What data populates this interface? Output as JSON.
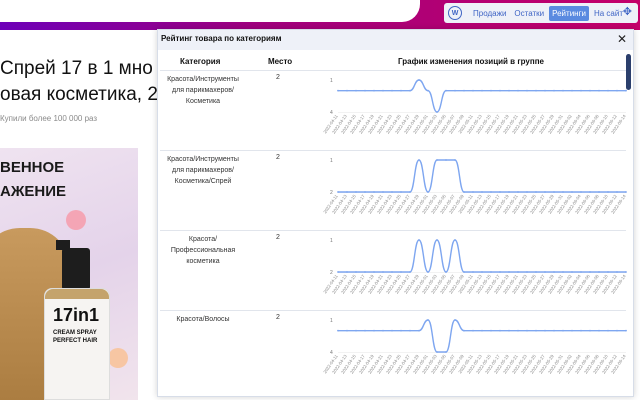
{
  "colors": {
    "accent": "#5a8ae0",
    "brand_top": "#a0007e",
    "line": "#7ea6f0"
  },
  "toolbar": {
    "logo": "W",
    "tabs": [
      {
        "label": "Продажи",
        "active": false
      },
      {
        "label": "Остатки",
        "active": false
      },
      {
        "label": "Рейтинги",
        "active": true
      },
      {
        "label": "На сайт",
        "active": false
      }
    ],
    "move_icon": "move-icon"
  },
  "page": {
    "title_line1": "Спрей 17 в 1 мно",
    "title_line2": "овая косметика, 2",
    "bought": "Купили более 100 000 раз",
    "promo_line1": "ВЕННОЕ",
    "promo_line2": "АЖЕНИЕ",
    "bottle_big": "17in1",
    "bottle_name": "CREAM SPRAY",
    "bottle_sub": "PERFECT HAIR"
  },
  "panel": {
    "title": "Рейтинг товара по категориям",
    "columns": {
      "category": "Категория",
      "place": "Место",
      "chart": "График изменения позиций в группе"
    },
    "rows": [
      {
        "category": "Красота/Инструменты для парикмахеров/Косметика",
        "place": "2"
      },
      {
        "category": "Красота/Инструменты для парикмахеров/Косметика/Спрей",
        "place": "2"
      },
      {
        "category": "Красота/ Профессиональная косметика",
        "place": "2"
      },
      {
        "category": "Красота/Волосы",
        "place": "2"
      }
    ]
  },
  "chart_data": [
    {
      "type": "line",
      "ylabels": [
        "1",
        "4"
      ],
      "ylim": [
        1,
        4
      ],
      "x": [
        "2022-04-11",
        "2022-04-13",
        "2022-04-15",
        "2022-04-17",
        "2022-04-19",
        "2022-04-21",
        "2022-04-23",
        "2022-04-25",
        "2022-04-27",
        "2022-04-29",
        "2022-05-01",
        "2022-05-03",
        "2022-05-05",
        "2022-05-07",
        "2022-05-09",
        "2022-05-11",
        "2022-05-13",
        "2022-05-15",
        "2022-05-17",
        "2022-05-19",
        "2022-05-21",
        "2022-05-23",
        "2022-05-25",
        "2022-05-27",
        "2022-05-29",
        "2022-05-31",
        "2022-06-02",
        "2022-06-04",
        "2022-06-06",
        "2022-06-08",
        "2022-06-10",
        "2022-06-12",
        "2022-06-14"
      ],
      "values": [
        2,
        2,
        2,
        2,
        2,
        2,
        2,
        2,
        2,
        1,
        2,
        4,
        2,
        2,
        2,
        2,
        2,
        2,
        2,
        2,
        2,
        2,
        2,
        2,
        2,
        2,
        2,
        2,
        2,
        2,
        2,
        2,
        2
      ]
    },
    {
      "type": "line",
      "ylabels": [
        "1",
        "2"
      ],
      "ylim": [
        1,
        2
      ],
      "x": [
        "2022-04-11",
        "2022-04-13",
        "2022-04-15",
        "2022-04-17",
        "2022-04-19",
        "2022-04-21",
        "2022-04-23",
        "2022-04-25",
        "2022-04-27",
        "2022-04-29",
        "2022-05-01",
        "2022-05-03",
        "2022-05-05",
        "2022-05-07",
        "2022-05-09",
        "2022-05-11",
        "2022-05-13",
        "2022-05-15",
        "2022-05-17",
        "2022-05-19",
        "2022-05-21",
        "2022-05-23",
        "2022-05-25",
        "2022-05-27",
        "2022-05-29",
        "2022-05-31",
        "2022-06-02",
        "2022-06-04",
        "2022-06-06",
        "2022-06-08",
        "2022-06-10",
        "2022-06-12",
        "2022-06-14"
      ],
      "values": [
        2,
        2,
        2,
        2,
        2,
        2,
        2,
        2,
        2,
        1,
        2,
        1,
        1,
        1,
        2,
        2,
        2,
        2,
        2,
        2,
        2,
        2,
        2,
        2,
        2,
        2,
        2,
        2,
        2,
        2,
        2,
        2,
        2
      ]
    },
    {
      "type": "line",
      "ylabels": [
        "1",
        "2"
      ],
      "ylim": [
        1,
        2
      ],
      "x": [
        "2022-04-11",
        "2022-04-13",
        "2022-04-15",
        "2022-04-17",
        "2022-04-19",
        "2022-04-21",
        "2022-04-23",
        "2022-04-25",
        "2022-04-27",
        "2022-04-29",
        "2022-05-01",
        "2022-05-03",
        "2022-05-05",
        "2022-05-07",
        "2022-05-09",
        "2022-05-11",
        "2022-05-13",
        "2022-05-15",
        "2022-05-17",
        "2022-05-19",
        "2022-05-21",
        "2022-05-23",
        "2022-05-25",
        "2022-05-27",
        "2022-05-29",
        "2022-05-31",
        "2022-06-02",
        "2022-06-04",
        "2022-06-06",
        "2022-06-08",
        "2022-06-10",
        "2022-06-12",
        "2022-06-14"
      ],
      "values": [
        2,
        2,
        2,
        2,
        2,
        2,
        2,
        2,
        2,
        1,
        2,
        1,
        2,
        1,
        2,
        2,
        2,
        2,
        2,
        2,
        2,
        2,
        2,
        2,
        2,
        2,
        2,
        2,
        2,
        2,
        2,
        2,
        2
      ]
    },
    {
      "type": "line",
      "ylabels": [
        "1",
        "4"
      ],
      "ylim": [
        1,
        4
      ],
      "x": [
        "2022-04-11",
        "2022-04-13",
        "2022-04-15",
        "2022-04-17",
        "2022-04-19",
        "2022-04-21",
        "2022-04-23",
        "2022-04-25",
        "2022-04-27",
        "2022-04-29",
        "2022-05-01",
        "2022-05-03",
        "2022-05-05",
        "2022-05-07",
        "2022-05-09",
        "2022-05-11",
        "2022-05-13",
        "2022-05-15",
        "2022-05-17",
        "2022-05-19",
        "2022-05-21",
        "2022-05-23",
        "2022-05-25",
        "2022-05-27",
        "2022-05-29",
        "2022-05-31",
        "2022-06-02",
        "2022-06-04",
        "2022-06-06",
        "2022-06-08",
        "2022-06-10",
        "2022-06-12",
        "2022-06-14"
      ],
      "values": [
        2,
        2,
        2,
        2,
        2,
        2,
        2,
        2,
        2,
        2,
        1,
        4,
        4,
        1,
        2,
        2,
        2,
        2,
        2,
        2,
        2,
        2,
        2,
        2,
        2,
        2,
        2,
        2,
        2,
        2,
        2,
        2,
        2
      ]
    }
  ]
}
